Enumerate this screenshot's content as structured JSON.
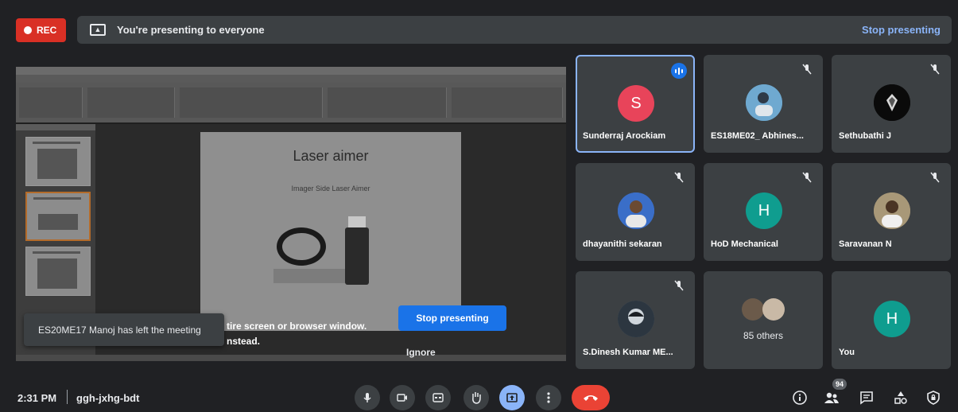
{
  "top_bar": {
    "rec_label": "REC",
    "presenting_text": "You're presenting to everyone",
    "stop_presenting_link": "Stop presenting"
  },
  "shared_screen": {
    "slide_title": "Laser aimer",
    "slide_subtitle": "Imager Side Laser Aimer",
    "notice_line1": "tire screen or browser window.",
    "notice_line2": "nstead.",
    "stop_button": "Stop presenting",
    "ignore_button": "Ignore"
  },
  "toast": {
    "text": "ES20ME17 Manoj has left the meeting"
  },
  "tiles": [
    {
      "name": "Sunderraj Arockiam",
      "initial": "S",
      "avatar_color": "#e8445a",
      "state": "speaking"
    },
    {
      "name": "ES18ME02_ Abhines...",
      "initial": "",
      "avatar_color": "#4a8fb8",
      "state": "muted"
    },
    {
      "name": "Sethubathi J",
      "initial": "",
      "avatar_color": "#111111",
      "state": "muted"
    },
    {
      "name": "dhayanithi sekaran",
      "initial": "",
      "avatar_color": "#3a6ec8",
      "state": "muted"
    },
    {
      "name": "HoD Mechanical",
      "initial": "H",
      "avatar_color": "#0f9d8f",
      "state": "muted"
    },
    {
      "name": "Saravanan N",
      "initial": "",
      "avatar_color": "#8a7a5e",
      "state": "muted"
    },
    {
      "name": "S.Dinesh Kumar ME...",
      "initial": "",
      "avatar_color": "#5a6a78",
      "state": "muted"
    },
    {
      "name": "",
      "others_label": "85 others",
      "state": "group"
    },
    {
      "name": "You",
      "initial": "H",
      "avatar_color": "#0f9d8f",
      "state": "self"
    }
  ],
  "bottom_bar": {
    "time": "2:31 PM",
    "meeting_code": "ggh-jxhg-bdt",
    "participants_count": "94"
  },
  "colors": {
    "background": "#202124",
    "tile": "#3c4043",
    "accent_blue": "#8ab4f8",
    "button_blue": "#1a73e8",
    "end_call_red": "#ea4335",
    "rec_red": "#d93025"
  }
}
